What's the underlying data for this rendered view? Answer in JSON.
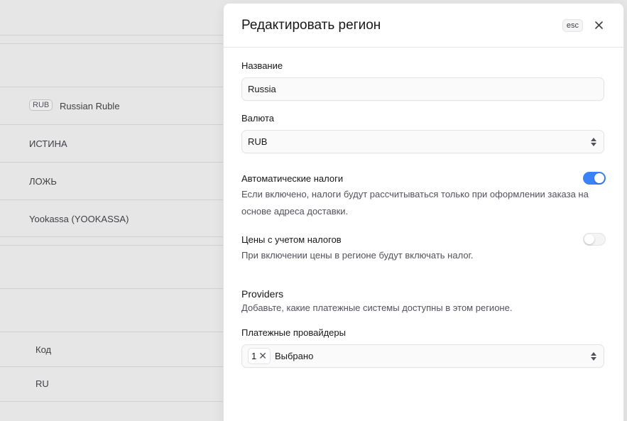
{
  "background": {
    "rows": [
      {
        "badge": "RUB",
        "text": "Russian Ruble"
      },
      {
        "text": "ИСТИНА"
      },
      {
        "text": "ЛОЖЬ"
      },
      {
        "text": "Yookassa (YOOKASSA)"
      }
    ],
    "table": {
      "header": "Код",
      "cell": "RU"
    }
  },
  "drawer": {
    "title": "Редактировать регион",
    "esc": "esc",
    "close_icon": "close-icon",
    "name": {
      "label": "Название",
      "value": "Russia"
    },
    "currency": {
      "label": "Валюта",
      "value": "RUB"
    },
    "auto_taxes": {
      "label": "Автоматические налоги",
      "help": "Если включено, налоги будут рассчитываться только при оформлении заказа на основе адреса доставки.",
      "enabled": true
    },
    "tax_inclusive": {
      "label": "Цены с учетом налогов",
      "help": "При включении цены в регионе будут включать налог.",
      "enabled": false
    },
    "providers": {
      "heading": "Providers",
      "help": "Добавьте, какие платежные системы доступны в этом регионе.",
      "field_label": "Платежные провайдеры",
      "selected_count": "1",
      "selected_text": "Выбрано"
    }
  },
  "colors": {
    "accent": "#3b82f6"
  }
}
